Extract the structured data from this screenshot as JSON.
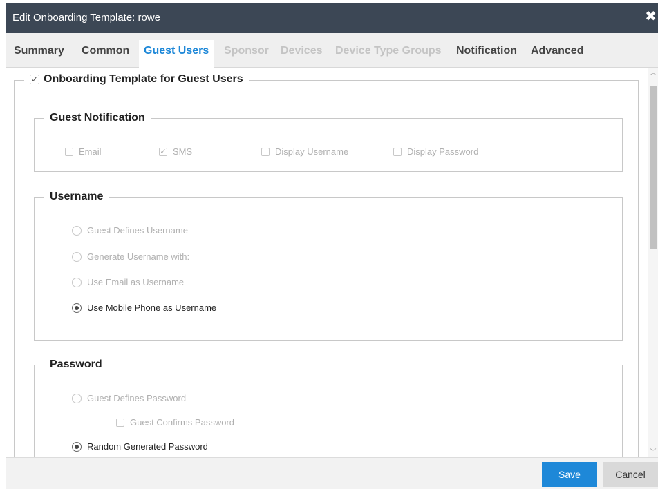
{
  "dialog": {
    "title": "Edit Onboarding Template: rowe",
    "close_icon": "close-icon"
  },
  "tabs": [
    {
      "label": "Summary",
      "state": "normal"
    },
    {
      "label": "Common",
      "state": "normal"
    },
    {
      "label": "Guest Users",
      "state": "active"
    },
    {
      "label": "Sponsor",
      "state": "disabled"
    },
    {
      "label": "Devices",
      "state": "disabled"
    },
    {
      "label": "Device Type Groups",
      "state": "disabled"
    },
    {
      "label": "Notification",
      "state": "normal"
    },
    {
      "label": "Advanced",
      "state": "normal"
    }
  ],
  "template_section": {
    "label": "Onboarding Template for Guest Users",
    "checked": true
  },
  "guest_notification": {
    "legend": "Guest Notification",
    "options": [
      {
        "label": "Email",
        "checked": false
      },
      {
        "label": "SMS",
        "checked": true
      },
      {
        "label": "Display Username",
        "checked": false
      },
      {
        "label": "Display Password",
        "checked": false
      }
    ]
  },
  "username": {
    "legend": "Username",
    "options": [
      {
        "label": "Guest Defines Username",
        "selected": false
      },
      {
        "label": "Generate Username with:",
        "selected": false
      },
      {
        "label": "Use Email as Username",
        "selected": false
      },
      {
        "label": "Use Mobile Phone as Username",
        "selected": true
      }
    ]
  },
  "password": {
    "legend": "Password",
    "guest_defines": {
      "label": "Guest Defines Password",
      "selected": false
    },
    "guest_confirms": {
      "label": "Guest Confirms Password",
      "checked": false
    },
    "random": {
      "label": "Random Generated Password",
      "selected": true
    }
  },
  "footer": {
    "save_label": "Save",
    "cancel_label": "Cancel"
  },
  "colors": {
    "titlebar": "#3c4755",
    "accent": "#1e88d8"
  }
}
